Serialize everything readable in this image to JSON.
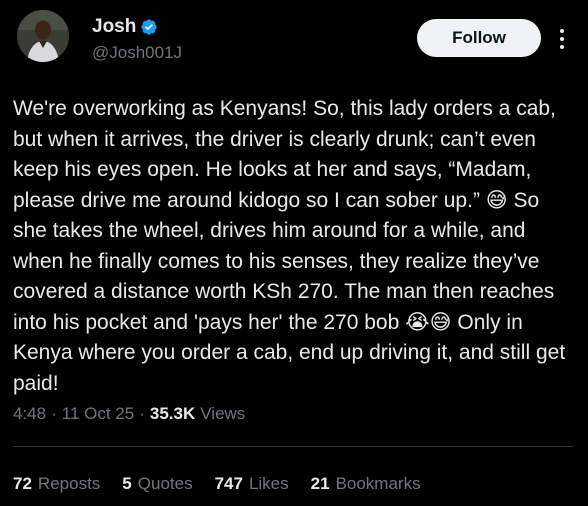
{
  "author": {
    "name": "Josh",
    "handle": "@Josh001J",
    "verified": true
  },
  "follow_label": "Follow",
  "tweet_text": "We're overworking as Kenyans! So, this lady orders a cab, but when it arrives, the driver is clearly drunk; can’t even keep his eyes open. He looks at her and says, “Madam, please drive me around kidogo so I can sober up.” 😅 So she takes the wheel, drives him around for a while, and when he finally comes to his senses, they realize they’ve covered a distance worth KSh 270. The man then reaches into his pocket and 'pays her' the 270 bob 😭😅 Only in Kenya where you order a cab, end up driving it, and still get paid!",
  "meta": {
    "time": "4:48",
    "date": "11 Oct 25",
    "views_count": "35.3K",
    "views_label": "Views"
  },
  "stats": [
    {
      "count": "72",
      "label": "Reposts"
    },
    {
      "count": "5",
      "label": "Quotes"
    },
    {
      "count": "747",
      "label": "Likes"
    },
    {
      "count": "21",
      "label": "Bookmarks"
    }
  ],
  "colors": {
    "background": "#000000",
    "text": "#e7e9ea",
    "muted": "#71767b",
    "verified": "#1d9bf0"
  }
}
